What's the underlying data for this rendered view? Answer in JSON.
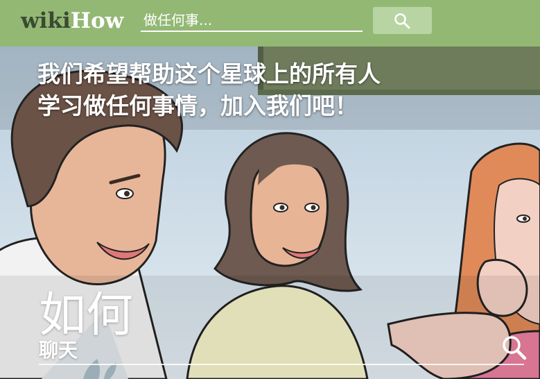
{
  "header": {
    "logo_wiki": "wiki",
    "logo_how": "How",
    "search_placeholder": "做任何事...",
    "background_color": "#93b874",
    "search_button_color": "#b8d4a2",
    "search_icon": "search-icon"
  },
  "hero": {
    "tagline_line1": "我们希望帮助这个星球上的所有人",
    "tagline_line2": "学习做任何事情，加入我们吧！",
    "howto_prefix": "如何",
    "howto_topic": "聊天",
    "bottom_search_icon": "search-icon"
  }
}
